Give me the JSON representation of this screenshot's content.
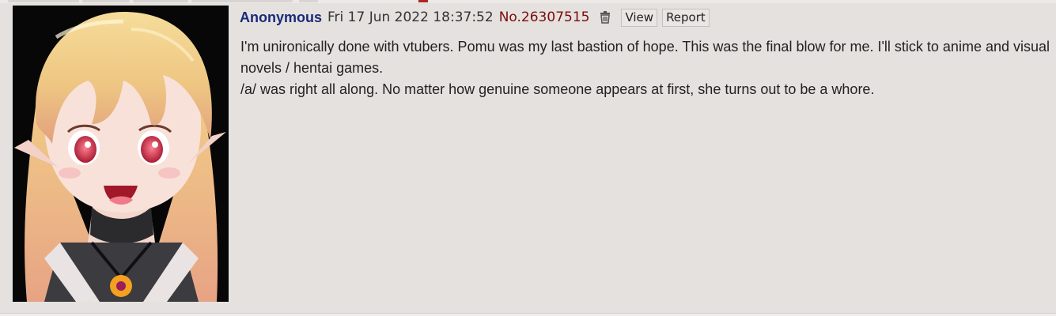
{
  "post": {
    "name": "Anonymous",
    "datetime": "Fri 17 Jun 2022 18:37:52",
    "post_number": "No.26307515",
    "view_label": "View",
    "report_label": "Report",
    "body_lines": [
      "I'm unironically done with vtubers. Pomu was my last bastion of hope. This was the final blow for me. I'll stick to anime and visual novels / hentai games.",
      "/a/ was right all along. No matter how genuine someone appears at first, she turns out to be a whore."
    ],
    "thumbnail": {
      "description_icon": "anime-girl-thumbnail"
    }
  },
  "colors": {
    "post_background": "#e4e1df",
    "name": "#1a2a79",
    "post_number": "#7c0b0b",
    "text": "#222222"
  }
}
